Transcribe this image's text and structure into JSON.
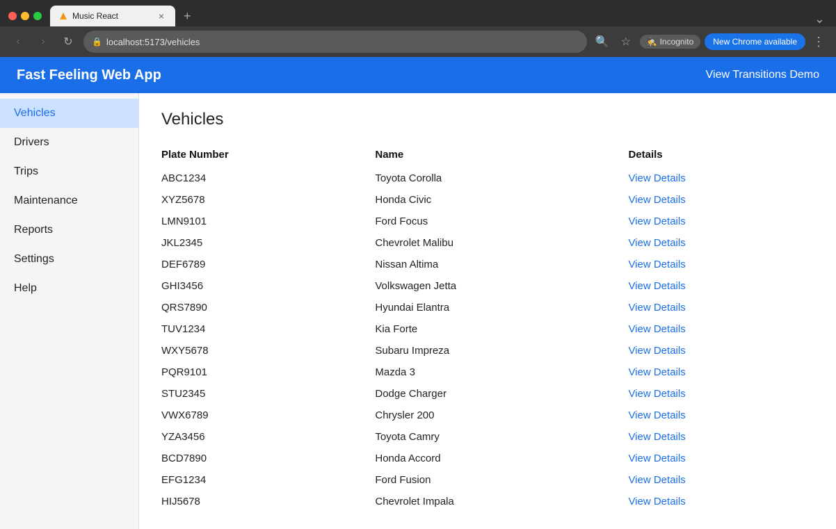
{
  "browser": {
    "tab_title": "Music React",
    "url": "localhost:5173/vehicles",
    "new_chrome_label": "New Chrome available",
    "incognito_label": "Incognito",
    "close_symbol": "×",
    "new_tab_symbol": "+",
    "back_symbol": "‹",
    "forward_symbol": "›",
    "reload_symbol": "↻",
    "search_icon": "🔍",
    "star_icon": "☆",
    "more_icon": "⋮"
  },
  "app": {
    "title": "Fast Feeling Web App",
    "transitions_link": "View Transitions Demo"
  },
  "sidebar": {
    "items": [
      {
        "label": "Vehicles",
        "active": true,
        "key": "vehicles"
      },
      {
        "label": "Drivers",
        "active": false,
        "key": "drivers"
      },
      {
        "label": "Trips",
        "active": false,
        "key": "trips"
      },
      {
        "label": "Maintenance",
        "active": false,
        "key": "maintenance"
      },
      {
        "label": "Reports",
        "active": false,
        "key": "reports"
      },
      {
        "label": "Settings",
        "active": false,
        "key": "settings"
      },
      {
        "label": "Help",
        "active": false,
        "key": "help"
      }
    ]
  },
  "main": {
    "page_title": "Vehicles",
    "table": {
      "columns": [
        "Plate Number",
        "Name",
        "Details"
      ],
      "rows": [
        {
          "plate": "ABC1234",
          "name": "Toyota Corolla",
          "details": "View Details"
        },
        {
          "plate": "XYZ5678",
          "name": "Honda Civic",
          "details": "View Details"
        },
        {
          "plate": "LMN9101",
          "name": "Ford Focus",
          "details": "View Details"
        },
        {
          "plate": "JKL2345",
          "name": "Chevrolet Malibu",
          "details": "View Details"
        },
        {
          "plate": "DEF6789",
          "name": "Nissan Altima",
          "details": "View Details"
        },
        {
          "plate": "GHI3456",
          "name": "Volkswagen Jetta",
          "details": "View Details"
        },
        {
          "plate": "QRS7890",
          "name": "Hyundai Elantra",
          "details": "View Details"
        },
        {
          "plate": "TUV1234",
          "name": "Kia Forte",
          "details": "View Details"
        },
        {
          "plate": "WXY5678",
          "name": "Subaru Impreza",
          "details": "View Details"
        },
        {
          "plate": "PQR9101",
          "name": "Mazda 3",
          "details": "View Details"
        },
        {
          "plate": "STU2345",
          "name": "Dodge Charger",
          "details": "View Details"
        },
        {
          "plate": "VWX6789",
          "name": "Chrysler 200",
          "details": "View Details"
        },
        {
          "plate": "YZA3456",
          "name": "Toyota Camry",
          "details": "View Details"
        },
        {
          "plate": "BCD7890",
          "name": "Honda Accord",
          "details": "View Details"
        },
        {
          "plate": "EFG1234",
          "name": "Ford Fusion",
          "details": "View Details"
        },
        {
          "plate": "HIJ5678",
          "name": "Chevrolet Impala",
          "details": "View Details"
        }
      ]
    }
  }
}
